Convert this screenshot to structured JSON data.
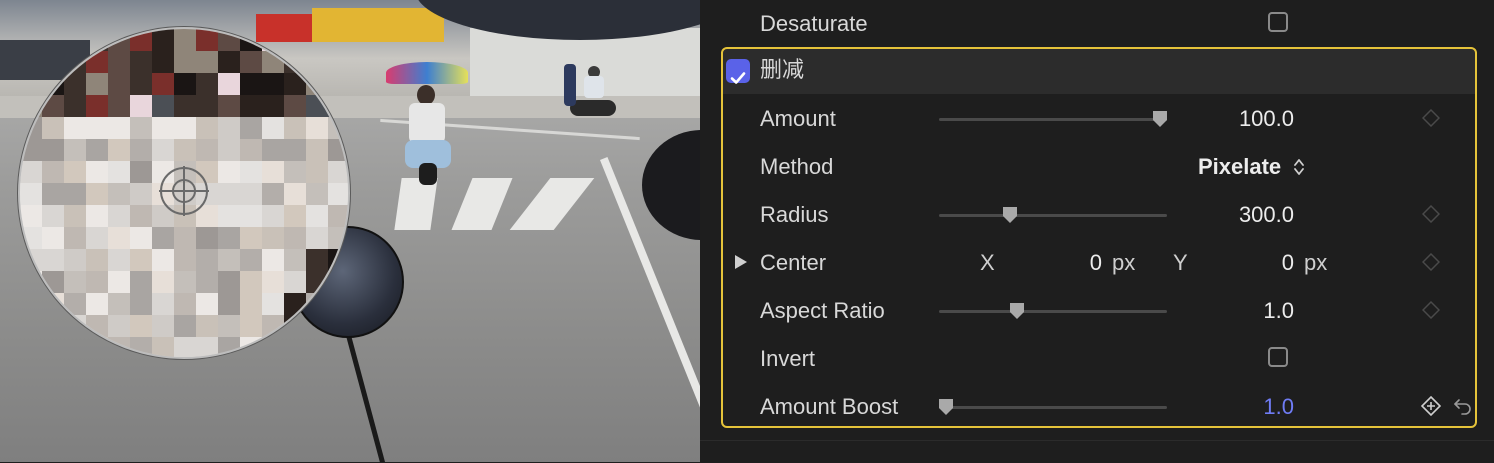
{
  "inspector": {
    "desaturate": {
      "label": "Desaturate",
      "checked": false
    },
    "effect": {
      "title": "删减",
      "enabled": true,
      "selected": true,
      "params": {
        "amount": {
          "label": "Amount",
          "value": "100.0",
          "slider_fraction": 0.97
        },
        "method": {
          "label": "Method",
          "value": "Pixelate"
        },
        "radius": {
          "label": "Radius",
          "value": "300.0",
          "slider_fraction": 0.31
        },
        "center": {
          "label": "Center",
          "x_label": "X",
          "x_value": "0",
          "x_unit": "px",
          "y_label": "Y",
          "y_value": "0",
          "y_unit": "px"
        },
        "aspect_ratio": {
          "label": "Aspect Ratio",
          "value": "1.0",
          "slider_fraction": 0.34
        },
        "invert": {
          "label": "Invert",
          "checked": false
        },
        "amount_boost": {
          "label": "Amount Boost",
          "value": "1.0",
          "slider_fraction": 0.03
        }
      }
    },
    "colors": {
      "accent_checkbox": "#5a62e8",
      "selection_outline": "#e5c33a",
      "modified_value": "#6f7cf5"
    }
  },
  "icons": {
    "keyframe": "diamond-icon",
    "keyframe_add": "diamond-plus-icon",
    "reset": "reset-arrow-icon",
    "expand": "disclosure-triangle-icon",
    "stepper": "up-down-chevron-icon",
    "onscreen_control": "crosshair-target-icon"
  }
}
